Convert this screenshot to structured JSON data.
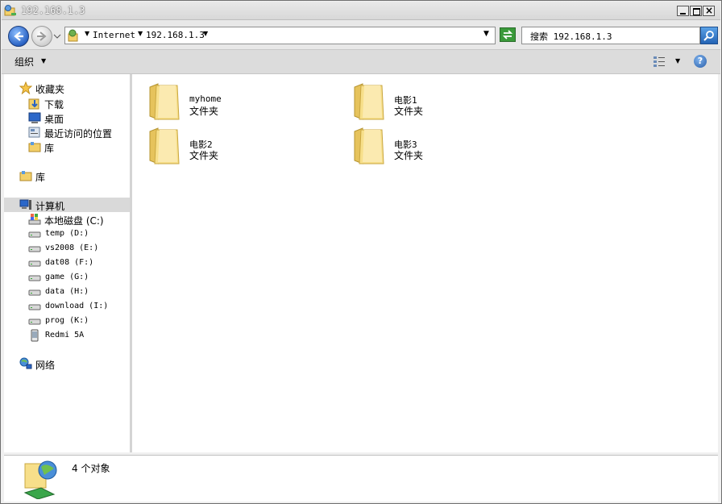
{
  "window": {
    "title": "192.168.1.3"
  },
  "address_bar": {
    "crumbs": [
      "Internet",
      "192.168.1.3"
    ]
  },
  "search": {
    "text": "搜索 192.168.1.3"
  },
  "toolbar": {
    "organize_label": "组织"
  },
  "nav_pane": {
    "favorites": {
      "label": "收藏夹",
      "items": [
        "下载",
        "桌面",
        "最近访问的位置",
        "库"
      ]
    },
    "libraries": {
      "label": "库"
    },
    "computer": {
      "label": "计算机",
      "drives": [
        "本地磁盘 (C:)",
        "temp (D:)",
        "vs2008 (E:)",
        "dat08 (F:)",
        "game (G:)",
        "data (H:)",
        "download (I:)",
        "prog (K:)",
        "Redmi 5A"
      ]
    },
    "network": {
      "label": "网络"
    }
  },
  "content": {
    "folders": [
      {
        "name": "myhome",
        "type": "文件夹"
      },
      {
        "name": "电影1",
        "type": "文件夹"
      },
      {
        "name": "电影2",
        "type": "文件夹"
      },
      {
        "name": "电影3",
        "type": "文件夹"
      }
    ]
  },
  "details": {
    "status": "4 个对象"
  }
}
